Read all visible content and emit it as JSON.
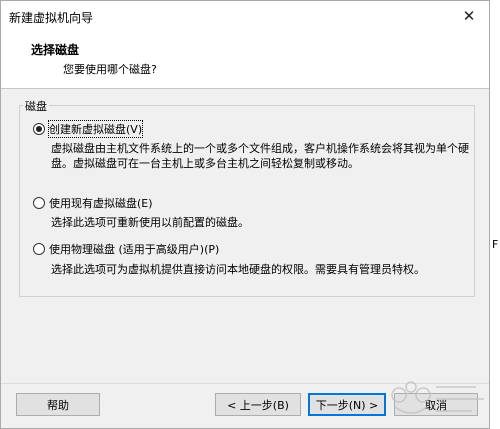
{
  "window": {
    "title": "新建虚拟机向导",
    "close_glyph": "✕"
  },
  "header": {
    "title": "选择磁盘",
    "subtitle": "您要使用哪个磁盘?"
  },
  "group": {
    "label": "磁盘"
  },
  "options": [
    {
      "label": "创建新虚拟磁盘(V)",
      "checked": true,
      "description": "虚拟磁盘由主机文件系统上的一个或多个文件组成，客户机操作系统会将其视为单个硬盘。虚拟磁盘可在一台主机上或多台主机之间轻松复制或移动。"
    },
    {
      "label": "使用现有虚拟磁盘(E)",
      "checked": false,
      "description": "选择此选项可重新使用以前配置的磁盘。"
    },
    {
      "label": "使用物理磁盘 (适用于高级用户)(P)",
      "checked": false,
      "description": "选择此选项可为虚拟机提供直接访问本地硬盘的权限。需要具有管理员特权。"
    }
  ],
  "buttons": {
    "help": "帮助",
    "back": "< 上一步(B)",
    "next": "下一步(N) >",
    "cancel": "取消"
  },
  "background": {
    "stray_char": "F"
  },
  "colors": {
    "window_bg": "#f0f0f0",
    "header_bg": "#ffffff",
    "default_button_border": "#0078d7"
  }
}
